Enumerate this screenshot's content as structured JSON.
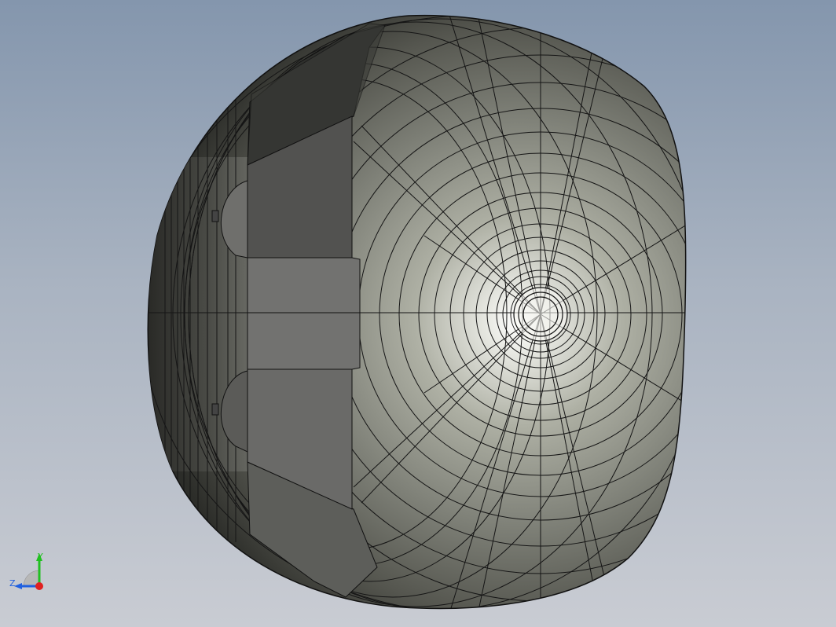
{
  "viewport": {
    "background_top": "#8496ad",
    "background_bottom": "#c9ccd3"
  },
  "model": {
    "edge_color": "#111111",
    "shell_highlight": "#f2f2ee",
    "shell_mid": "#8d8f86",
    "shell_dark": "#2a2b28",
    "boss_face_light": "#7a7a78",
    "boss_face_dark": "#4a4a48"
  },
  "triad": {
    "x_axis_color": "#e02020",
    "y_axis_color": "#20c020",
    "z_axis_color": "#2060e0",
    "y_label": "Y",
    "z_label": "Z"
  }
}
